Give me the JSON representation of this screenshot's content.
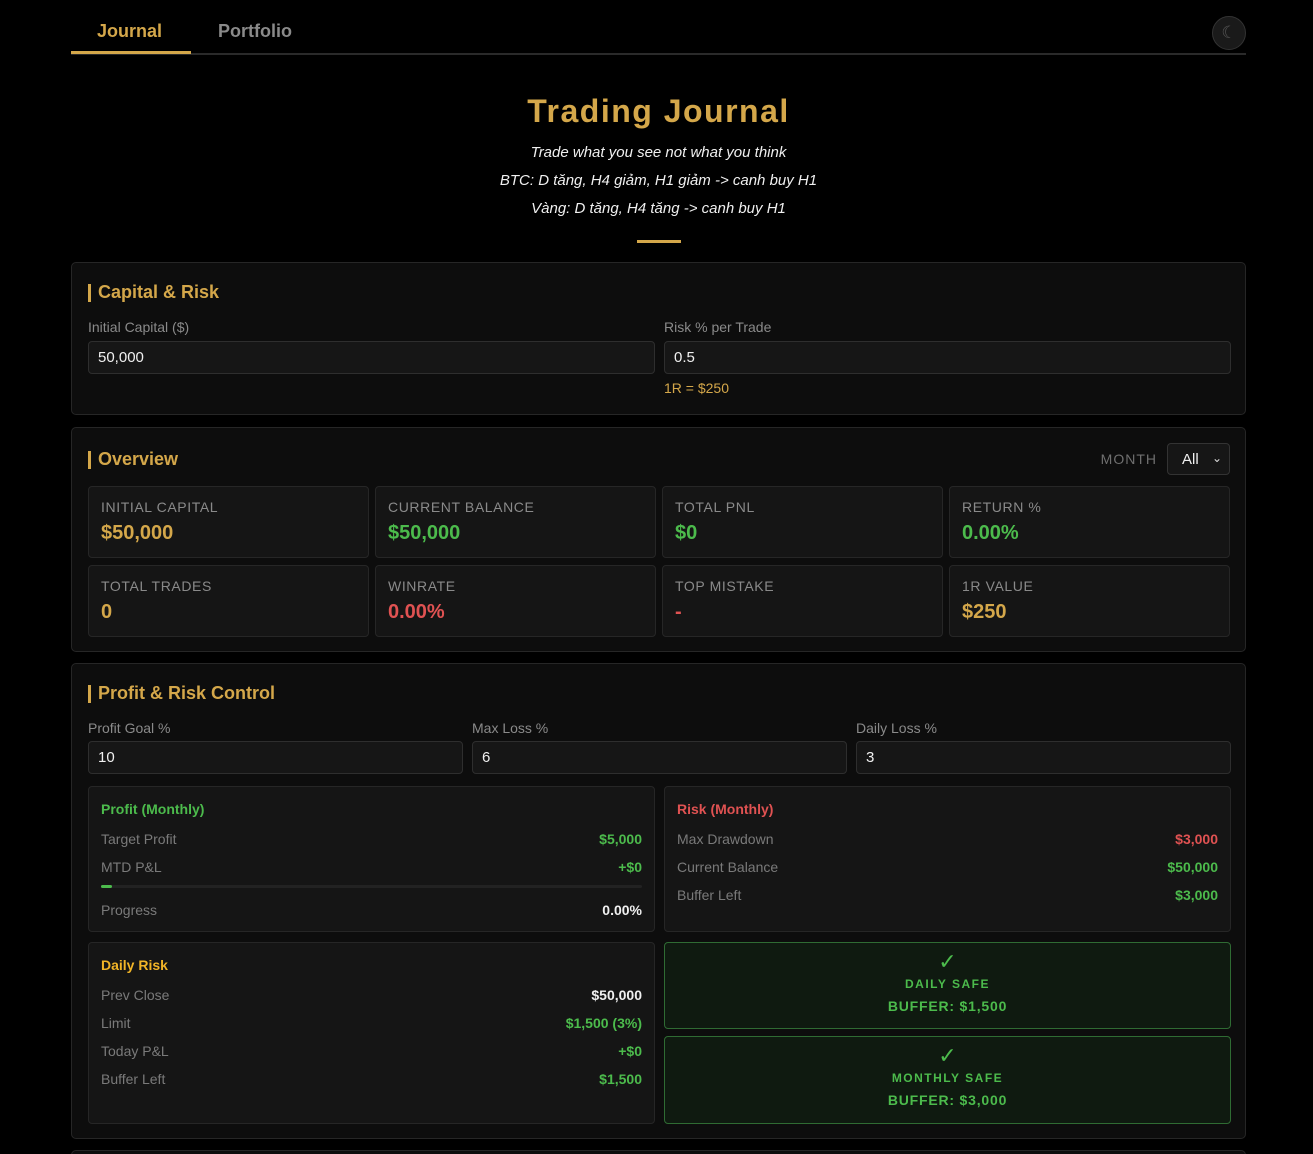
{
  "tabs": [
    {
      "label": "Journal",
      "active": true
    },
    {
      "label": "Portfolio",
      "active": false
    }
  ],
  "theme_toggle": {
    "icon": "moon-icon",
    "glyph": "☾"
  },
  "header": {
    "title": "Trading Journal",
    "lines": [
      "Trade what you see not what you think",
      "BTC: D tăng, H4 giảm, H1 giảm -> canh buy H1",
      "Vàng: D tăng, H4 tăng -> canh buy H1"
    ]
  },
  "capital": {
    "title": "Capital & Risk",
    "initial_label": "Initial Capital ($)",
    "initial_value": "50,000",
    "risk_label": "Risk % per Trade",
    "risk_value": "0.5",
    "r_hint": "1R = $250"
  },
  "overview": {
    "title": "Overview",
    "month_label": "MONTH",
    "month_value": "All",
    "stats": [
      {
        "label": "INITIAL CAPITAL",
        "value": "$50,000",
        "color": "#d4a74a"
      },
      {
        "label": "CURRENT BALANCE",
        "value": "$50,000",
        "color": "#4cbb4c"
      },
      {
        "label": "TOTAL PNL",
        "value": "$0",
        "color": "#4cbb4c"
      },
      {
        "label": "RETURN %",
        "value": "0.00%",
        "color": "#4cbb4c"
      },
      {
        "label": "TOTAL TRADES",
        "value": "0",
        "color": "#d4a74a"
      },
      {
        "label": "WINRATE",
        "value": "0.00%",
        "color": "#e05252"
      },
      {
        "label": "TOP MISTAKE",
        "value": "-",
        "color": "#e05252"
      },
      {
        "label": "1R VALUE",
        "value": "$250",
        "color": "#d4a74a"
      }
    ]
  },
  "control": {
    "title": "Profit & Risk Control",
    "profit_goal_label": "Profit Goal %",
    "profit_goal_value": "10",
    "max_loss_label": "Max Loss %",
    "max_loss_value": "6",
    "daily_loss_label": "Daily Loss %",
    "daily_loss_value": "3",
    "profit": {
      "title": "Profit (Monthly)",
      "target_label": "Target Profit",
      "target_value": "$5,000",
      "mtd_label": "MTD P&L",
      "mtd_value": "+$0",
      "progress_label": "Progress",
      "progress_value": "0.00%",
      "progress_fraction": 0.02
    },
    "risk": {
      "title": "Risk (Monthly)",
      "drawdown_label": "Max Drawdown",
      "drawdown_value": "$3,000",
      "balance_label": "Current Balance",
      "balance_value": "$50,000",
      "buffer_label": "Buffer Left",
      "buffer_value": "$3,000"
    },
    "daily": {
      "title": "Daily Risk",
      "prev_label": "Prev Close",
      "prev_value": "$50,000",
      "limit_label": "Limit",
      "limit_value": "$1,500 (3%)",
      "today_label": "Today P&L",
      "today_value": "+$0",
      "buffer_label": "Buffer Left",
      "buffer_value": "$1,500"
    },
    "daily_safe": {
      "check": "✓",
      "title": "DAILY SAFE",
      "buffer": "BUFFER: $1,500"
    },
    "monthly_safe": {
      "check": "✓",
      "title": "MONTHLY SAFE",
      "buffer": "BUFFER: $3,000"
    }
  }
}
